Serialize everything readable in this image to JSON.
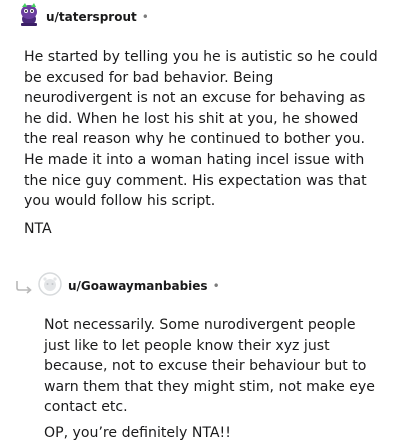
{
  "comments": [
    {
      "username": "u/tatersprout",
      "separator": "•",
      "avatar_icon": "snoo-avatar-icon",
      "paragraphs": [
        "He started by telling you he is autistic so he could be excused for bad behavior. Being neurodivergent is not an excuse for behaving as he did. When he lost his shit at you, he showed the real reason why he continued to bother you. He made it into a woman hating incel issue with the nice guy comment. His expectation was that you would follow his script.",
        "NTA"
      ]
    },
    {
      "username": "u/Goawaymanbabies",
      "separator": "•",
      "avatar_icon": "default-avatar-icon",
      "reply_icon": "reply-arrow-icon",
      "paragraphs": [
        "Not necessarily. Some nurodivergent people just like to let people know their xyz just because, not to excuse their behaviour but to warn them that they might stim, not make eye contact etc.",
        "OP, you’re definitely NTA!!"
      ]
    }
  ],
  "colors": {
    "text": "#1a1a1b",
    "meta": "#7c7c7c",
    "avatar_purple": "#6b3fa0",
    "avatar_green": "#46d160",
    "default_avatar": "#d7dadc"
  }
}
